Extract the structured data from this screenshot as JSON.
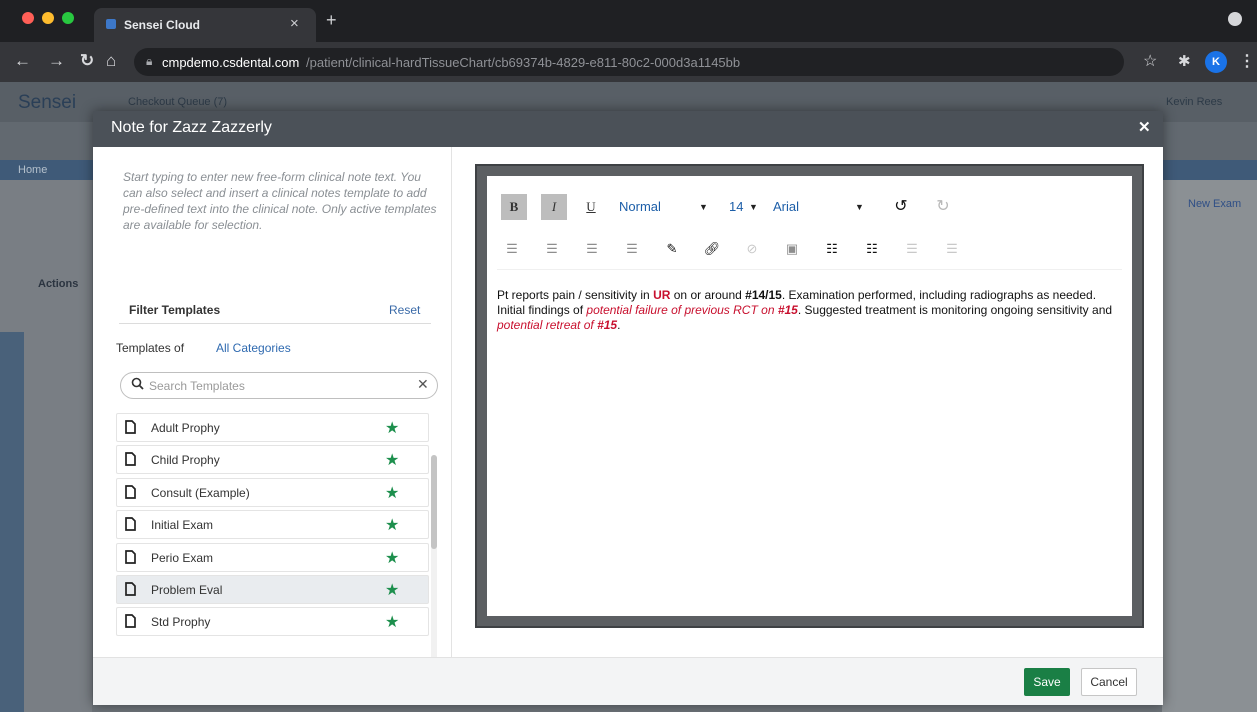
{
  "browser": {
    "tab_title": "Sensei Cloud",
    "url_host": "cmpdemo.csdental.com",
    "url_path": "/patient/clinical-hardTissueChart/cb69374b-4829-e811-80c2-000d3a1145bb",
    "profile_initial": "K"
  },
  "background_app": {
    "logo": "Sensei",
    "queue_label": "Checkout Queue (7)",
    "user_menu": "Kevin Rees",
    "nav_home": "Home",
    "actions_label": "Actions",
    "new_exam": "New Exam"
  },
  "modal": {
    "title": "Note for Zazz Zazzerly",
    "help_text": "Start typing to enter new free-form clinical note text. You can also select and insert a clinical notes template to add pre-defined text into the clinical note. Only active templates are available for selection.",
    "filter_title": "Filter Templates",
    "reset_label": "Reset",
    "templates_of_label": "Templates of",
    "categories_link": "All Categories",
    "search_placeholder": "Search Templates",
    "templates": [
      {
        "label": "Adult Prophy",
        "favorite": true,
        "selected": false
      },
      {
        "label": "Child Prophy",
        "favorite": true,
        "selected": false
      },
      {
        "label": "Consult (Example)",
        "favorite": true,
        "selected": false
      },
      {
        "label": "Initial Exam",
        "favorite": true,
        "selected": false
      },
      {
        "label": "Perio Exam",
        "favorite": true,
        "selected": false
      },
      {
        "label": "Problem Eval",
        "favorite": true,
        "selected": true
      },
      {
        "label": "Std Prophy",
        "favorite": true,
        "selected": false
      }
    ],
    "editor": {
      "bold_label": "B",
      "italic_label": "I",
      "underline_label": "U",
      "style_value": "Normal",
      "size_value": "14",
      "font_value": "Arial",
      "note": {
        "t1": "Pt reports pain / sensitivity in ",
        "t2": "UR",
        "t3": " on or around ",
        "t4": "#14/15",
        "t5": ". Examination performed, including radiographs as needed. Initial findings of ",
        "t6": "potential failure of previous RCT on ",
        "t7": "#15",
        "t8": ". Suggested treatment is monitoring ongoing sensitivity and ",
        "t9": "potential retreat of ",
        "t10": "#15",
        "t11": "."
      }
    },
    "save_label": "Save",
    "cancel_label": "Cancel"
  },
  "colors": {
    "save_green": "#1a7f45",
    "favorite_star": "#1d8f4d",
    "highlight_red": "#c8102e",
    "link_blue": "#2f6ab0"
  }
}
